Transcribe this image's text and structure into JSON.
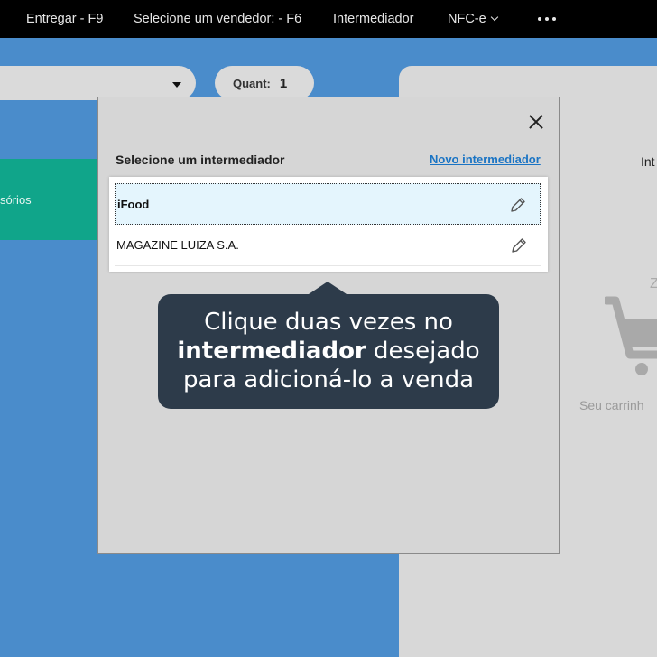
{
  "topbar": {
    "deliver": "Entregar - F9",
    "seller": "Selecione um vendedor: - F6",
    "intermediary": "Intermediador",
    "nfce": "NFC-e"
  },
  "product_bar": {
    "quant_label": "Quant:",
    "quant_value": "1"
  },
  "category": {
    "label": "sórios"
  },
  "cart": {
    "header": "Int",
    "zz": "Z",
    "empty_text": "Seu carrinh"
  },
  "modal": {
    "title": "Selecione um intermediador",
    "new_link": "Novo intermediador",
    "items": [
      {
        "name": "iFood"
      },
      {
        "name": "MAGAZINE LUIZA S.A."
      }
    ]
  },
  "tooltip": {
    "line1": "Clique duas vezes no",
    "bold": "intermediador",
    "line2_rest": " desejado",
    "line3": "para adicioná-lo a venda"
  },
  "colors": {
    "background": "#4a8ccb",
    "topbar": "#000000",
    "category": "#10a58a",
    "tooltip": "#2d3b4a",
    "link": "#1a74c4"
  }
}
